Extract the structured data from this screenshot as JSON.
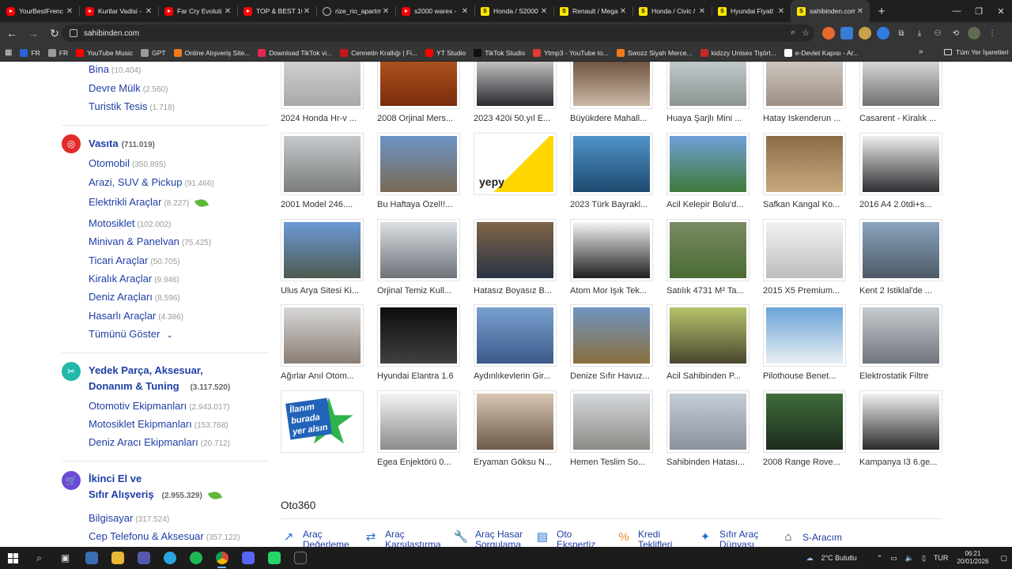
{
  "tabs": [
    {
      "label": "YourBestFrenc",
      "icon": "youtube-icon"
    },
    {
      "label": "Kurtlar Vadisi -",
      "icon": "youtube-icon"
    },
    {
      "label": "Far Cry Evoluti",
      "icon": "youtube-icon"
    },
    {
      "label": "TOP & BEST 10",
      "icon": "youtube-icon"
    },
    {
      "label": "rize_rio_apartm",
      "icon": "globe-icon"
    },
    {
      "label": "s2000 warex -",
      "icon": "youtube-icon"
    },
    {
      "label": "Honda / S2000",
      "icon": "sahibinden-icon"
    },
    {
      "label": "Renault / Mega",
      "icon": "sahibinden-icon"
    },
    {
      "label": "Honda / Civic /",
      "icon": "sahibinden-icon"
    },
    {
      "label": "Hyundai Fiyatl",
      "icon": "sahibinden-icon"
    },
    {
      "label": "sahibinden.com",
      "icon": "sahibinden-icon",
      "active": true
    }
  ],
  "address": {
    "url": "sahibinden.com"
  },
  "bookmarks": [
    {
      "label": "FR",
      "color": "#2a62d6"
    },
    {
      "label": "FR",
      "color": "#9a9a9a"
    },
    {
      "label": "YouTube Music",
      "color": "#ff0000"
    },
    {
      "label": "GPT",
      "color": "#9a9a9a"
    },
    {
      "label": "Online Alışveriş Site...",
      "color": "#f27a1a"
    },
    {
      "label": "Download TikTok vi...",
      "color": "#e6284f"
    },
    {
      "label": "Cennetin Krallığı | Fi...",
      "color": "#c4161c"
    },
    {
      "label": "YT Studio",
      "color": "#ff0000"
    },
    {
      "label": "TikTok Studio",
      "color": "#111111"
    },
    {
      "label": "Ytmp3 - YouTube to...",
      "color": "#e53935"
    },
    {
      "label": "Swozz Siyah Merce...",
      "color": "#f27a1a"
    },
    {
      "label": "kidzzy Unisex Tişört...",
      "color": "#c62828"
    },
    {
      "label": "e-Devlet Kapısı - Ar...",
      "color": "#ffffff"
    }
  ],
  "bookmarks_folder": "Tüm Yer İşaretleri",
  "sidebar": {
    "emlak_items": [
      {
        "label": "Bina",
        "count": "(10.404)"
      },
      {
        "label": "Devre Mülk",
        "count": "(2.560)"
      },
      {
        "label": "Turistik Tesis",
        "count": "(1.718)"
      }
    ],
    "vasita": {
      "title": "Vasıta",
      "count": "(711.019)",
      "items": [
        {
          "label": "Otomobil",
          "count": "(350.895)"
        },
        {
          "label": "Arazi, SUV & Pickup",
          "count": "(91.466)"
        },
        {
          "label": "Elektrikli Araçlar",
          "count": "(8.227)"
        },
        {
          "label": "Motosiklet",
          "count": "(102.002)"
        },
        {
          "label": "Minivan & Panelvan",
          "count": "(75.425)"
        },
        {
          "label": "Ticari Araçlar",
          "count": "(50.705)"
        },
        {
          "label": "Kiralık Araçlar",
          "count": "(9.946)"
        },
        {
          "label": "Deniz Araçları",
          "count": "(8.596)"
        },
        {
          "label": "Hasarlı Araçlar",
          "count": "(4.386)"
        }
      ],
      "show_all": "Tümünü Göster"
    },
    "yedek": {
      "title_line1": "Yedek Parça, Aksesuar,",
      "title_line2": "Donanım & Tuning",
      "count": "(3.117.520)",
      "items": [
        {
          "label": "Otomotiv Ekipmanları",
          "count": "(2.943.017)"
        },
        {
          "label": "Motosiklet Ekipmanları",
          "count": "(153.768)"
        },
        {
          "label": "Deniz Aracı Ekipmanları",
          "count": "(20.712)"
        }
      ]
    },
    "ikinci_el": {
      "title_line1": "İkinci El ve",
      "title_line2": "Sıfır Alışveriş",
      "count": "(2.955.329)",
      "items": [
        {
          "label": "Bilgisayar",
          "count": "(317.524)"
        },
        {
          "label": "Cep Telefonu & Aksesuar",
          "count": "(357.122)"
        }
      ]
    }
  },
  "listings": [
    {
      "caption": "2024 Honda Hr-v ...",
      "bg": "linear-gradient(#d8d9d8,#a8aaa8)"
    },
    {
      "caption": "2008 Orjinal Mers...",
      "bg": "linear-gradient(#b85a22,#7a2c0c)"
    },
    {
      "caption": "2023 420i 50.yıl E...",
      "bg": "linear-gradient(#e9e9e9,#2a2a30)"
    },
    {
      "caption": "Büyükdere Mahall...",
      "bg": "linear-gradient(#5a3a28,#c9b8a4)"
    },
    {
      "caption": "Huaya Şarjlı Mini ...",
      "bg": "linear-gradient(#cfd6dc,#8c9490)"
    },
    {
      "caption": "Hatay Iskenderun ...",
      "bg": "linear-gradient(#d9d4cf,#9e8f83)"
    },
    {
      "caption": "Casarent - Kiralık ...",
      "bg": "linear-gradient(#f3f3f3,#6f6f6f)"
    },
    {
      "caption": "2001 Model 246....",
      "bg": "linear-gradient(#c6c9cc,#7a7d7c)"
    },
    {
      "caption": "Bu Haftaya Özel!!...",
      "bg": "linear-gradient(#6c93c5,#7a6a55)"
    },
    {
      "caption": "",
      "bg": "linear-gradient(135deg,#ffffff 55%,#ffd600 55%)",
      "logo": "yepy"
    },
    {
      "caption": "2023 Türk Bayrakl...",
      "bg": "linear-gradient(#4f93c8,#1d4a70)"
    },
    {
      "caption": "Acil Kelepir Bolu'd...",
      "bg": "linear-gradient(#6fa0d8,#3f7a3a)"
    },
    {
      "caption": "Safkan Kangal Ko...",
      "bg": "linear-gradient(#8c6b49,#c8a97e)"
    },
    {
      "caption": "2016 A4 2.0tdi+s...",
      "bg": "linear-gradient(#eeeeee,#2c2e31)"
    },
    {
      "caption": "Ulus Arya Sitesi Ki...",
      "bg": "linear-gradient(#6c9ad6,#4d5a4e)"
    },
    {
      "caption": "Orjinal Temiz Kull...",
      "bg": "linear-gradient(#dadfe4,#6e7379)"
    },
    {
      "caption": "Hatasız Boyasız B...",
      "bg": "linear-gradient(#7f6447,#2a3445)"
    },
    {
      "caption": "Atom Mor Işık Tek...",
      "bg": "linear-gradient(#f4f4f4,#1e1e1e)"
    },
    {
      "caption": "Satılık 4731 M² Ta...",
      "bg": "linear-gradient(#7a8b63,#4a6b34)"
    },
    {
      "caption": "2015 X5 Premium...",
      "bg": "linear-gradient(#f2f2f2,#bdbdbd)"
    },
    {
      "caption": "Kent 2 Istiklal'de ...",
      "bg": "linear-gradient(#8aa4bf,#4e5a66)"
    },
    {
      "caption": "Ağırlar Anıl Otom...",
      "bg": "linear-gradient(#d7d7d7,#8b7e74)"
    },
    {
      "caption": "Hyundai Elantra 1.6",
      "bg": "linear-gradient(#0d0d0d,#404040)"
    },
    {
      "caption": "Aydınlıkevlerin Gir...",
      "bg": "linear-gradient(#79a0cf,#3b5a8a)"
    },
    {
      "caption": "Denize Sıfır Havuz...",
      "bg": "linear-gradient(#6f94c2,#8a6e3c)"
    },
    {
      "caption": "Acil Sahibinden P...",
      "bg": "linear-gradient(#b7c36a,#4a4630)"
    },
    {
      "caption": "Pilothouse Benet...",
      "bg": "linear-gradient(#6aa4d6,#e9eef3)"
    },
    {
      "caption": "Elektrostatik Filtre",
      "bg": "linear-gradient(#c6cbd0,#6f757b)"
    },
    {
      "caption": "",
      "bg": "#ffffff",
      "logo": "ilan"
    },
    {
      "caption": "Egea Enjektörü 0...",
      "bg": "linear-gradient(#f3f3f3,#8b8b8b)"
    },
    {
      "caption": "Eryaman Göksu N...",
      "bg": "linear-gradient(#d8c7b3,#6c5a4b)"
    },
    {
      "caption": "Hemen Teslim So...",
      "bg": "linear-gradient(#d4d8dc,#8d8a85)"
    },
    {
      "caption": "Sahibinden Hatası...",
      "bg": "linear-gradient(#c4ccd6,#8a939c)"
    },
    {
      "caption": "2008 Range Rove...",
      "bg": "linear-gradient(#3f6d3b,#1d2b1c)"
    },
    {
      "caption": "Kampanya I3 6.ge...",
      "bg": "linear-gradient(#f0f0f0,#2b2b2b)"
    }
  ],
  "logos": {
    "yepy": "yepy",
    "ilan_l1": "İlanım",
    "ilan_l2": "burada",
    "ilan_l3": "yer alsın"
  },
  "oto360": {
    "title": "Oto360",
    "tools": [
      {
        "l1": "Araç",
        "l2": "Değerleme",
        "icon": "chart-icon"
      },
      {
        "l1": "Araç",
        "l2": "Karşılaştırma",
        "icon": "compare-icon"
      },
      {
        "l1": "Araç Hasar",
        "l2": "Sorgulama",
        "icon": "wrench-icon"
      },
      {
        "l1": "Oto",
        "l2": "Ekspertiz",
        "icon": "document-icon"
      },
      {
        "l1": "Kredi",
        "l2": "Teklifleri",
        "icon": "percent-icon"
      },
      {
        "l1": "Sıfır Araç",
        "l2": "Dünyası",
        "icon": "sparkle-icon"
      },
      {
        "l1": "S-Aracım",
        "l2": "",
        "icon": "garage-icon"
      }
    ]
  },
  "taskbar": {
    "weather": "2°C  Bulutlu",
    "lang": "TUR",
    "time": "06:21",
    "date": "20/01/2026"
  }
}
